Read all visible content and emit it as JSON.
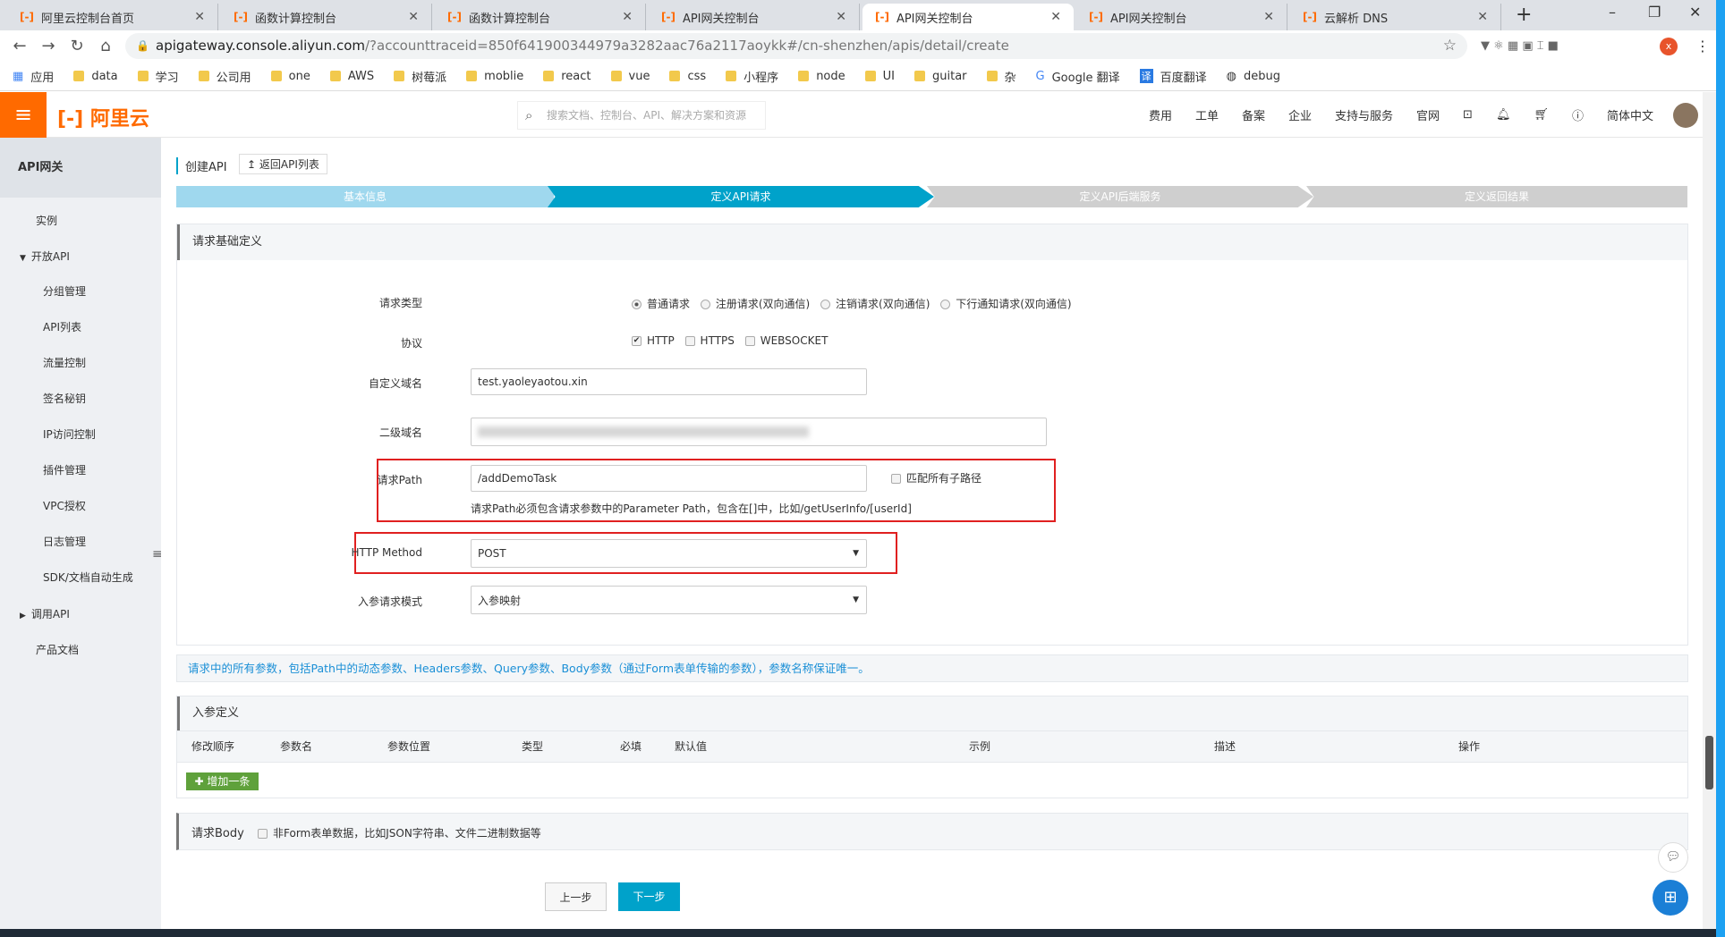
{
  "browser": {
    "tabs": [
      {
        "label": "阿里云控制台首页"
      },
      {
        "label": "函数计算控制台"
      },
      {
        "label": "函数计算控制台"
      },
      {
        "label": "API网关控制台"
      },
      {
        "label": "API网关控制台",
        "active": true
      },
      {
        "label": "API网关控制台"
      },
      {
        "label": "云解析 DNS"
      }
    ],
    "url_host": "apigateway.console.aliyun.com",
    "url_rest": "/?accounttraceid=850f641900344979a3282aac76a2117aoykk#/cn-shenzhen/apis/detail/create",
    "bookmarks": [
      "应用",
      "data",
      "学习",
      "公司用",
      "one",
      "AWS",
      "树莓派",
      "moblie",
      "react",
      "vue",
      "css",
      "小程序",
      "node",
      "UI",
      "guitar",
      "杂",
      "Google 翻译",
      "百度翻译",
      "debug"
    ]
  },
  "header": {
    "logo": "阿里云",
    "search_placeholder": "搜索文档、控制台、API、解决方案和资源",
    "nav": [
      "费用",
      "工单",
      "备案",
      "企业",
      "支持与服务",
      "官网"
    ],
    "language": "简体中文"
  },
  "sidebar": {
    "title": "API网关",
    "items": [
      "实例",
      "开放API",
      "分组管理",
      "API列表",
      "流量控制",
      "签名秘钥",
      "IP访问控制",
      "插件管理",
      "VPC授权",
      "日志管理",
      "SDK/文档自动生成",
      "调用API",
      "产品文档"
    ]
  },
  "page": {
    "title": "创建API",
    "back": "返回API列表",
    "steps": [
      "基本信息",
      "定义API请求",
      "定义API后端服务",
      "定义返回结果"
    ],
    "section_title": "请求基础定义",
    "request_type": {
      "label": "请求类型",
      "options": [
        "普通请求",
        "注册请求(双向通信)",
        "注销请求(双向通信)",
        "下行通知请求(双向通信)"
      ],
      "selected": "普通请求"
    },
    "protocol": {
      "label": "协议",
      "options": [
        "HTTP",
        "HTTPS",
        "WEBSOCKET"
      ],
      "checked": [
        "HTTP"
      ]
    },
    "custom_domain": {
      "label": "自定义域名",
      "value": "test.yaoleyaotou.xin"
    },
    "sub_domain": {
      "label": "二级域名"
    },
    "path": {
      "label": "请求Path",
      "value": "/addDemoTask",
      "match_all": "匹配所有子路径",
      "help": "请求Path必须包含请求参数中的Parameter Path，包含在[]中，比如/getUserInfo/[userId]"
    },
    "method": {
      "label": "HTTP Method",
      "value": "POST"
    },
    "mode": {
      "label": "入参请求模式",
      "value": "入参映射"
    },
    "info": "请求中的所有参数，包括Path中的动态参数、Headers参数、Query参数、Body参数（通过Form表单传输的参数），参数名称保证唯一。",
    "params": {
      "title": "入参定义",
      "columns": [
        "修改顺序",
        "参数名",
        "参数位置",
        "类型",
        "必填",
        "默认值",
        "示例",
        "描述",
        "操作"
      ],
      "add": "增加一条"
    },
    "body": {
      "title": "请求Body",
      "checkbox": "非Form表单数据，比如JSON字符串、文件二进制数据等"
    },
    "prev": "上一步",
    "next": "下一步"
  }
}
